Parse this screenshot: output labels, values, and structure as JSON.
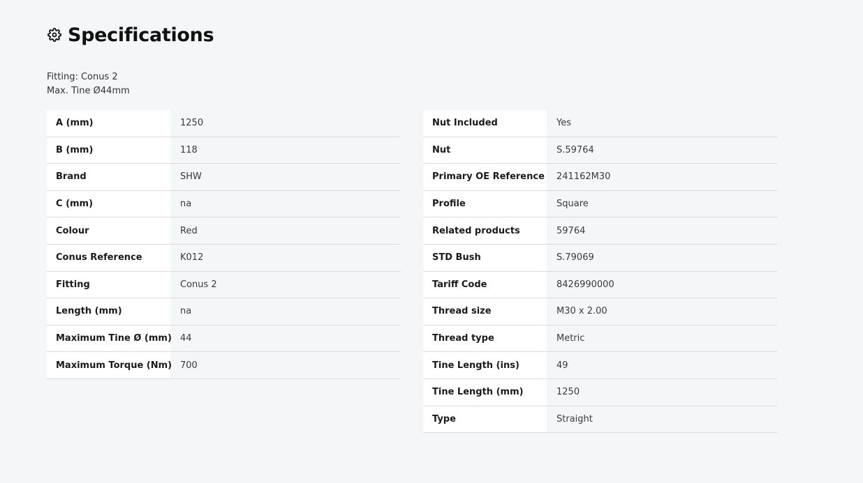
{
  "header": {
    "title": "Specifications",
    "icon": "gear-icon"
  },
  "meta": {
    "fitting": "Fitting: Conus 2",
    "max_tine": "Max. Tine Ø44mm"
  },
  "left_table": [
    {
      "label": "A (mm)",
      "value": "1250"
    },
    {
      "label": "B (mm)",
      "value": "118"
    },
    {
      "label": "Brand",
      "value": "SHW"
    },
    {
      "label": "C (mm)",
      "value": "na"
    },
    {
      "label": "Colour",
      "value": "Red"
    },
    {
      "label": "Conus Reference",
      "value": "K012"
    },
    {
      "label": "Fitting",
      "value": "Conus 2"
    },
    {
      "label": "Length (mm)",
      "value": "na"
    },
    {
      "label": "Maximum Tine Ø (mm)",
      "value": "44"
    },
    {
      "label": "Maximum Torque (Nm)",
      "value": "700"
    }
  ],
  "right_table": [
    {
      "label": "Nut Included",
      "value": "Yes"
    },
    {
      "label": "Nut",
      "value": "S.59764"
    },
    {
      "label": "Primary OE Reference",
      "value": "241162M30"
    },
    {
      "label": "Profile",
      "value": "Square"
    },
    {
      "label": "Related products",
      "value": "59764"
    },
    {
      "label": "STD Bush",
      "value": "S.79069"
    },
    {
      "label": "Tariff Code",
      "value": "8426990000"
    },
    {
      "label": "Thread size",
      "value": "M30 x 2.00"
    },
    {
      "label": "Thread type",
      "value": "Metric"
    },
    {
      "label": "Tine Length (ins)",
      "value": "49"
    },
    {
      "label": "Tine Length (mm)",
      "value": "1250"
    },
    {
      "label": "Type",
      "value": "Straight"
    }
  ]
}
